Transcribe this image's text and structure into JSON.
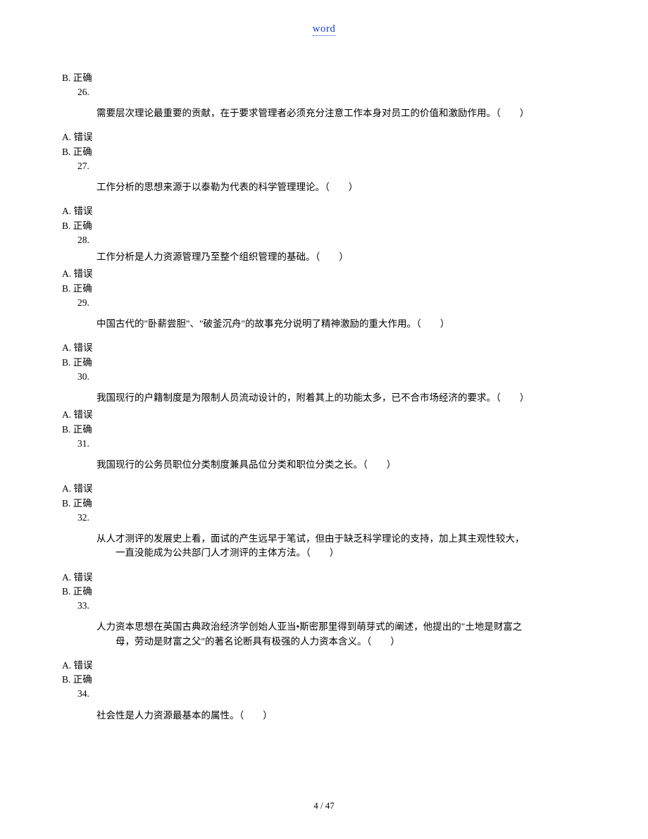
{
  "header": {
    "title": "word"
  },
  "options": {
    "A": "A. 错误",
    "B": "B. 正确"
  },
  "q26": {
    "num": "26.",
    "text": "需要层次理论最重要的贡献，在于要求管理者必须充分注意工作本身对员工的价值和激励作用。（　　）"
  },
  "q27": {
    "num": "27.",
    "text": "工作分析的思想来源于以泰勒为代表的科学管理理论。（　　）"
  },
  "q28": {
    "num": "28.",
    "text": "工作分析是人力资源管理乃至整个组织管理的基础。（　　）"
  },
  "q29": {
    "num": "29.",
    "text": "中国古代的\"卧薪尝胆\"、\"破釜沉舟\"的故事充分说明了精神激励的重大作用。（　　）"
  },
  "q30": {
    "num": "30.",
    "text": "我国现行的户籍制度是为限制人员流动设计的，附着其上的功能太多，已不合市场经济的要求。（　　）"
  },
  "q31": {
    "num": "31.",
    "text": "我国现行的公务员职位分类制度兼具品位分类和职位分类之长。（　　）"
  },
  "q32": {
    "num": "32.",
    "text": "从人才测评的发展史上看，面试的产生远早于笔试，但由于缺乏科学理论的支持，加上其主观性较大，",
    "text2": "一直没能成为公共部门人才测评的主体方法。（　　）"
  },
  "q33": {
    "num": "33.",
    "text": "人力资本思想在英国古典政治经济学创始人亚当•斯密那里得到萌芽式的阐述，他提出的\"土地是财富之",
    "text2": "母，劳动是财富之父\"的著名论断具有极强的人力资本含义。（　　）"
  },
  "q34": {
    "num": "34.",
    "text": "社会性是人力资源最基本的属性。（　　）"
  },
  "footer": {
    "page": "4 / 47"
  }
}
